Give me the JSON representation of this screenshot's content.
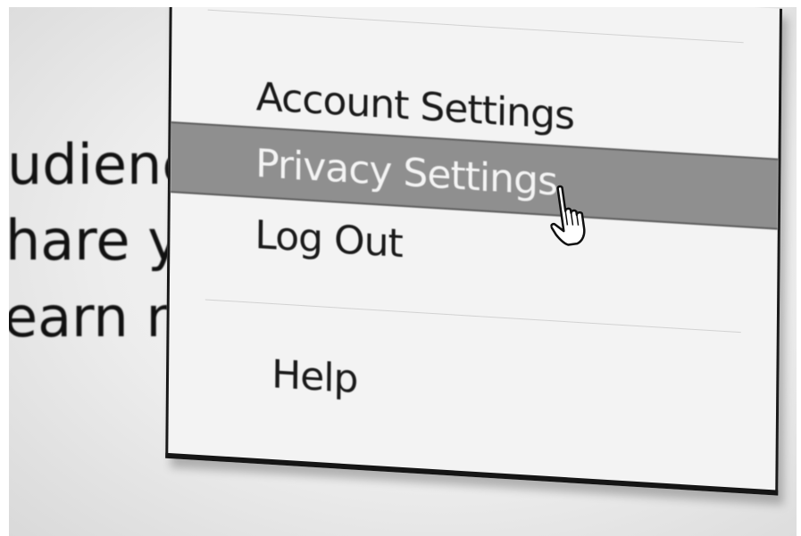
{
  "background_text": {
    "line1": "udience",
    "line2": "hare yo",
    "line3": "earn mo"
  },
  "menu": {
    "items": [
      {
        "label": "Account Settings"
      },
      {
        "label": "Privacy Settings",
        "highlighted": true
      },
      {
        "label": "Log Out"
      },
      {
        "label": "Help"
      }
    ]
  },
  "cursor": {
    "icon": "hand-pointer-icon"
  },
  "colors": {
    "highlight": "#8f8f8f",
    "highlight_text": "#f4f4f4",
    "menu_background": "#f3f3f3",
    "border": "#1a1a1a"
  }
}
